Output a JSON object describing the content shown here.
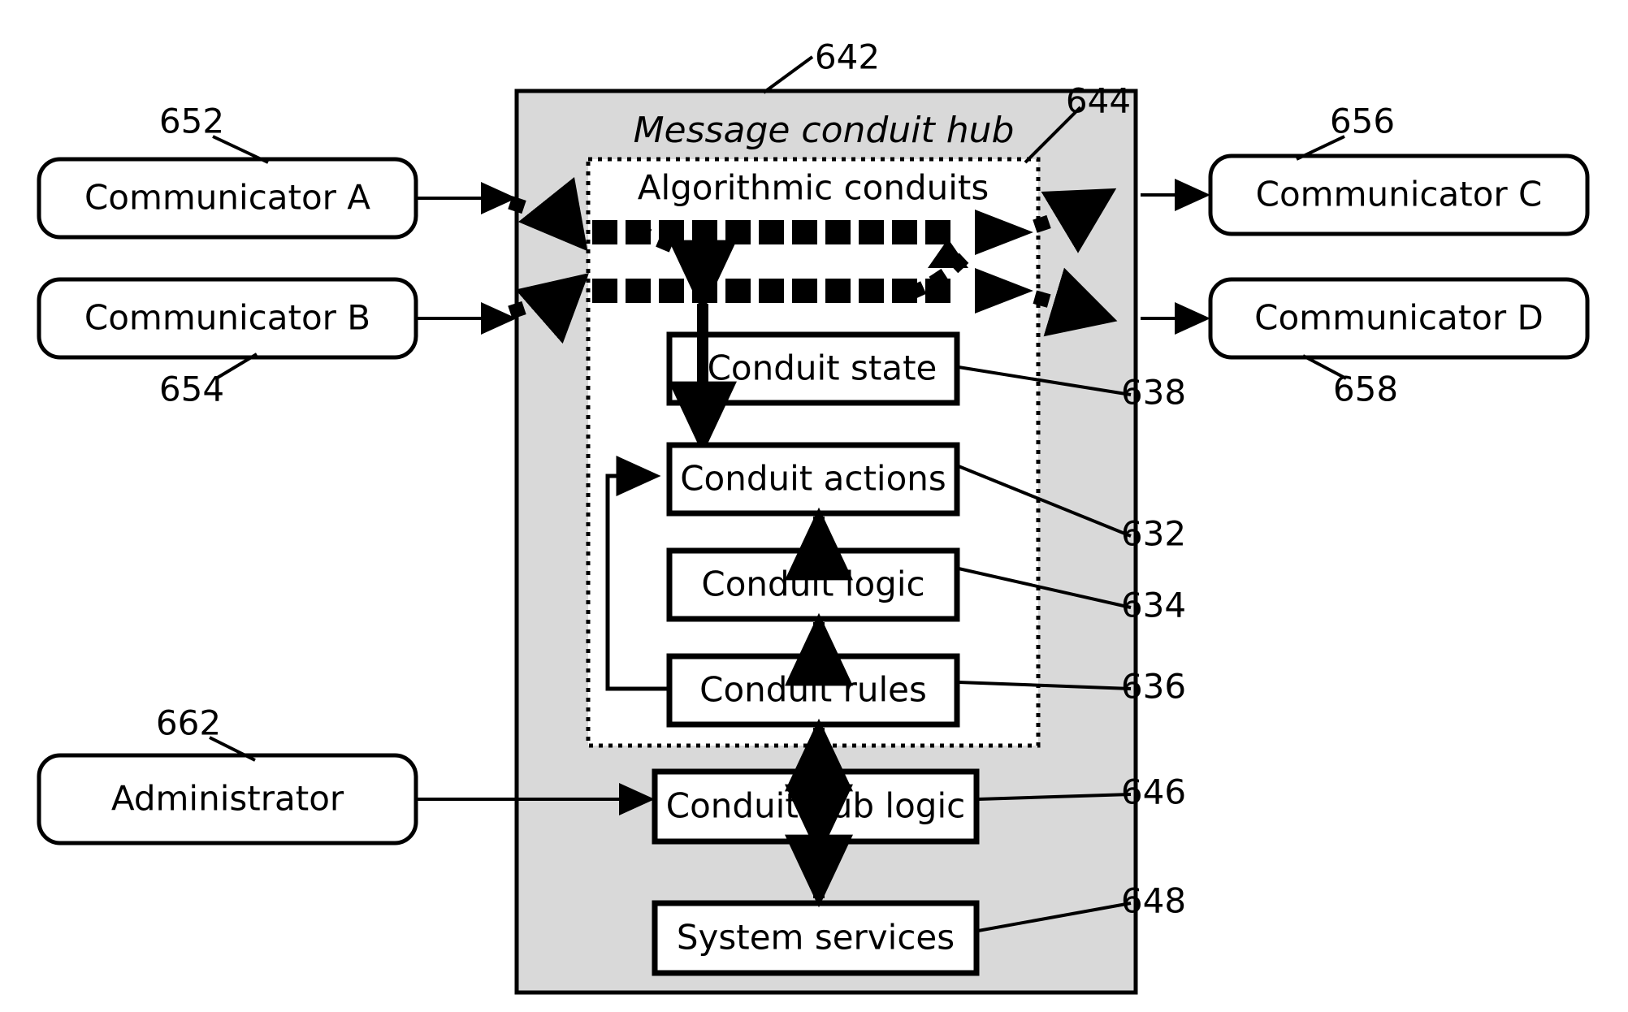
{
  "figure": {
    "type": "patent-block-diagram",
    "hub": {
      "title": "Message conduit hub",
      "ref": "642",
      "fill_color": "#d9d9d9",
      "inner_panel": {
        "title": "Algorithmic conduits",
        "ref": "644",
        "border_style": "dotted"
      }
    },
    "left_nodes": [
      {
        "label": "Communicator A",
        "ref": "652"
      },
      {
        "label": "Communicator B",
        "ref": "654"
      },
      {
        "label": "Administrator",
        "ref": "662"
      }
    ],
    "right_nodes": [
      {
        "label": "Communicator C",
        "ref": "656"
      },
      {
        "label": "Communicator D",
        "ref": "658"
      }
    ],
    "hub_boxes": [
      {
        "label": "Conduit state",
        "ref": "638"
      },
      {
        "label": "Conduit actions",
        "ref": "632"
      },
      {
        "label": "Conduit logic",
        "ref": "634"
      },
      {
        "label": "Conduit rules",
        "ref": "636"
      },
      {
        "label": "Conduit hub logic",
        "ref": "646"
      },
      {
        "label": "System services",
        "ref": "648"
      }
    ],
    "conduit_rows": 2,
    "colors": {
      "stroke": "#000000",
      "hub_fill": "#d9d9d9",
      "panel_fill": "#ffffff",
      "page_bg": "#ffffff"
    }
  }
}
